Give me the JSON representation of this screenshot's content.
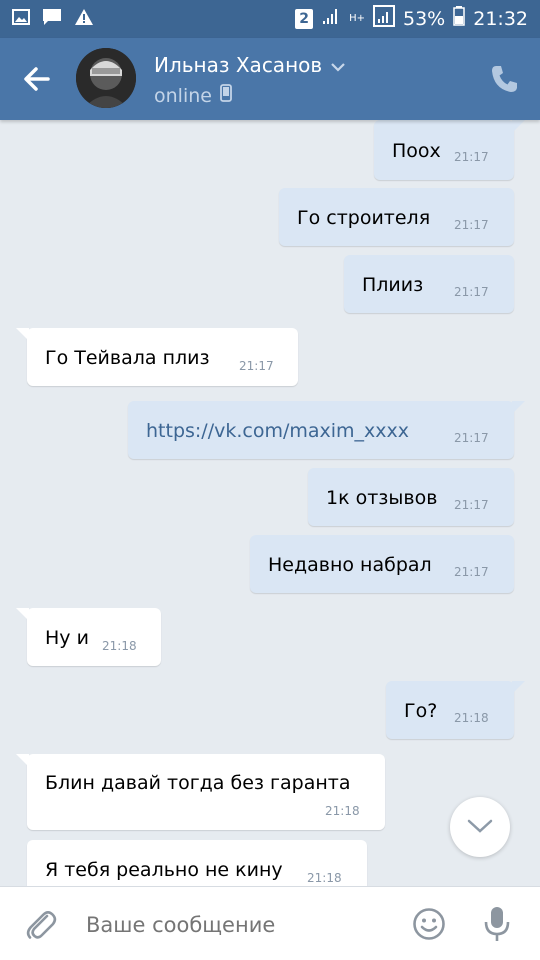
{
  "status_bar": {
    "sim_badge": "2",
    "data_label": "H+",
    "battery": "53%",
    "time": "21:32"
  },
  "header": {
    "contact_name": "Ильназ Хасанов",
    "status": "online"
  },
  "messages": [
    {
      "text": "Поох",
      "time": "21:17",
      "dir": "out"
    },
    {
      "text": "Го строителя",
      "time": "21:17",
      "dir": "out"
    },
    {
      "text": "Плииз",
      "time": "21:17",
      "dir": "out"
    },
    {
      "text": "Го Тейвала плиз",
      "time": "21:17",
      "dir": "in"
    },
    {
      "text": "https://vk.com/maxim_xxxx",
      "time": "21:17",
      "dir": "out"
    },
    {
      "text": "1к отзывов",
      "time": "21:17",
      "dir": "out"
    },
    {
      "text": "Недавно набрал",
      "time": "21:17",
      "dir": "out"
    },
    {
      "text": "Ну и",
      "time": "21:18",
      "dir": "in"
    },
    {
      "text": "Го?",
      "time": "21:18",
      "dir": "out"
    },
    {
      "text": "Блин давай тогда без гаранта",
      "time": "21:18",
      "dir": "in"
    },
    {
      "text": "Я тебя реально не кину",
      "time": "21:18",
      "dir": "in"
    }
  ],
  "composer": {
    "placeholder": "Ваше сообщение"
  },
  "icons": {
    "back": "arrow-left-icon",
    "call": "phone-icon",
    "mobile": "mobile-device-icon",
    "attach": "paperclip-icon",
    "emoji": "smiley-icon",
    "mic": "microphone-icon",
    "scroll": "chevron-down-icon"
  },
  "colors": {
    "header": "#4a76a8",
    "status_bar": "#3d6693",
    "chat_bg": "#e6ebf0",
    "outgoing_bubble": "#dae6f4",
    "incoming_bubble": "#ffffff",
    "link": "#3d6693"
  }
}
